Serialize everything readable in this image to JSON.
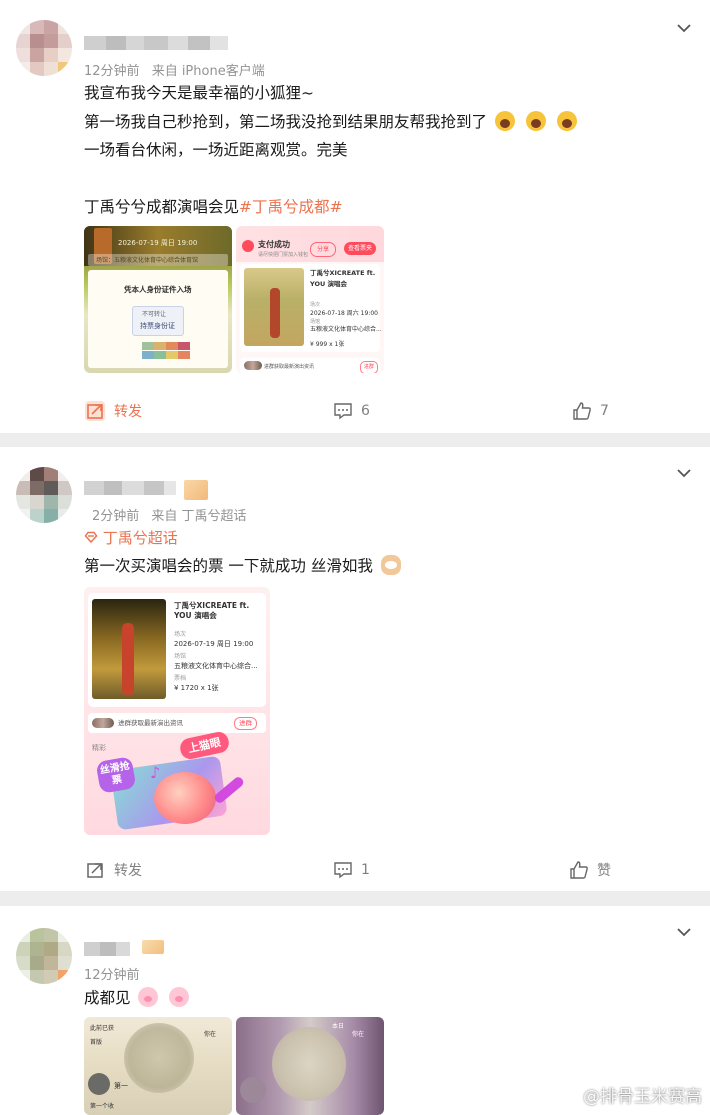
{
  "posts": [
    {
      "time": "12分钟前",
      "source": "来自 iPhone客户端",
      "lines": [
        "我宣布我今天是最幸福的小狐狸~",
        "第一场我自己秒抢到，第二场我没抢到结果朋友帮我抢到了",
        "一场看台休闲，一场近距离观赏。完美"
      ],
      "line4_prefix": "丁禹兮兮成都演唱会见",
      "line4_topic": "#丁禹兮成都#",
      "images": [
        {
          "date_text": "2026-07-19 周日 19:00",
          "venue_text": "场馆：五粮液文化体育中心综合体育馆",
          "entry_title": "凭本人身份证件入场",
          "badge": "不可转让",
          "card_text": "持票身份证"
        },
        {
          "pay_status": "支付成功",
          "pay_sub": "请尽快把门票加入钱包",
          "share": "分享",
          "view_ticket": "查看票夹",
          "show_title": "丁禹兮XICREATE ft. YOU 演唱会",
          "label_time": "场次",
          "date": "2026-07-18 周六 19:00",
          "label_venue": "场馆",
          "venue": "五粮液文化体育中心综合...",
          "price": "¥ 999 x 1张",
          "footer": "进群获取最新演出资讯",
          "footer_btn": "进群"
        }
      ],
      "repost_label": "转发",
      "comment_count": "6",
      "like_count": "7"
    },
    {
      "time": "2分钟前",
      "source": "来自 丁禹兮超话",
      "supertopic": "丁禹兮超话",
      "text": "第一次买演唱会的票 一下就成功 丝滑如我",
      "ticket": {
        "show_title": "丁禹兮XICREATE ft. YOU 演唱会",
        "label_time": "场次",
        "date": "2026-07-19 周日 19:00",
        "label_venue": "场馆",
        "venue": "五粮液文化体育中心综合...",
        "label_price": "票档",
        "price": "¥ 1720 x 1张",
        "footer": "进群获取最新演出资讯",
        "footer_btn": "进群",
        "wonderful": "精彩",
        "promo1": "丝滑抢票",
        "promo2": "上猫眼"
      },
      "repost_label": "转发",
      "comment_count": "1",
      "like_label": "赞"
    },
    {
      "time": "12分钟前",
      "text": "成都见",
      "image_left_text": [
        "此前已获",
        "你在",
        "首版",
        "第一",
        "第一个收"
      ],
      "image_right_text": [
        "你在",
        "本日"
      ]
    }
  ],
  "watermark": "@排骨玉米赛高"
}
